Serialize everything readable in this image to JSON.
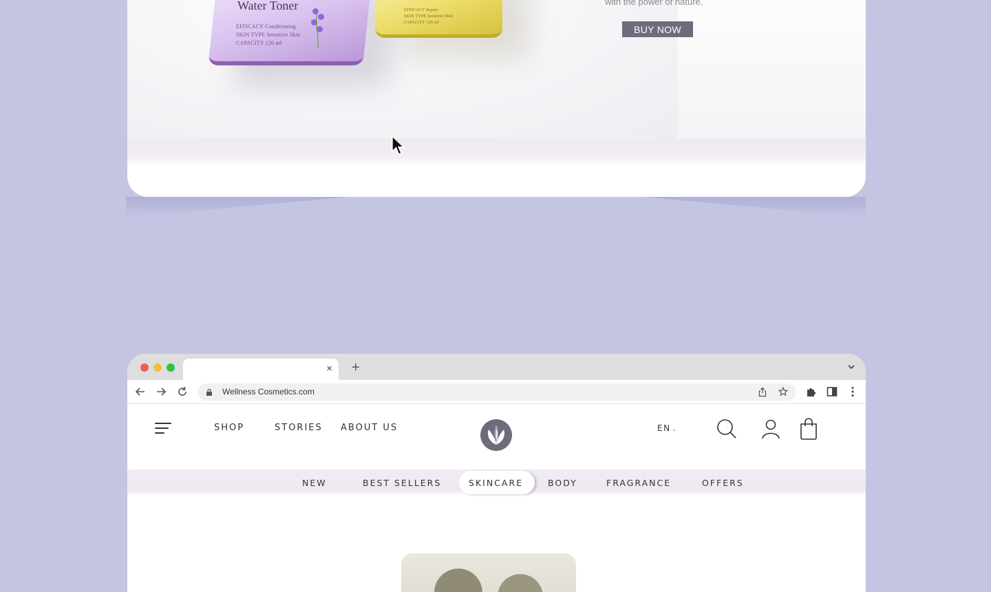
{
  "hero": {
    "product_title": "Water Toner",
    "spec_lines": [
      "EFFICACY   Conditioning",
      "SKIN TYPE  Sensitive Skin",
      "CAPACITY   120 ml"
    ],
    "spec_lines_yellow": [
      "EFFICACY   Repair",
      "SKIN TYPE  Sensitive Skin",
      "CAPACITY   120 ml"
    ],
    "tagline": "with the power of nature.",
    "buy_now_label": "BUY NOW"
  },
  "browser": {
    "url": "Wellness Cosmetics.com",
    "new_tab_label": "+",
    "close_tab_label": "×"
  },
  "header": {
    "nav": [
      "SHOP",
      "STORIES",
      "ABOUT US"
    ],
    "language": "EN",
    "language_caret": "⌄"
  },
  "categories": {
    "items": [
      "NEW",
      "BEST SELLERS",
      "SKINCARE",
      "BODY",
      "FRAGRANCE",
      "OFFERS"
    ],
    "active": "SKINCARE"
  },
  "colors": {
    "page_background": "#c3c5e2",
    "button": "#6e6b7c",
    "category_band": "#efe8f1",
    "logo": "#6e6b7c",
    "traffic_red": "#ee5e55",
    "traffic_yellow": "#f4be3d",
    "traffic_green": "#32c148"
  },
  "icons": {
    "menu": "hamburger-icon",
    "search": "search-icon",
    "account": "user-icon",
    "cart": "shopping-bag-icon",
    "logo": "leaf-logo-icon"
  }
}
